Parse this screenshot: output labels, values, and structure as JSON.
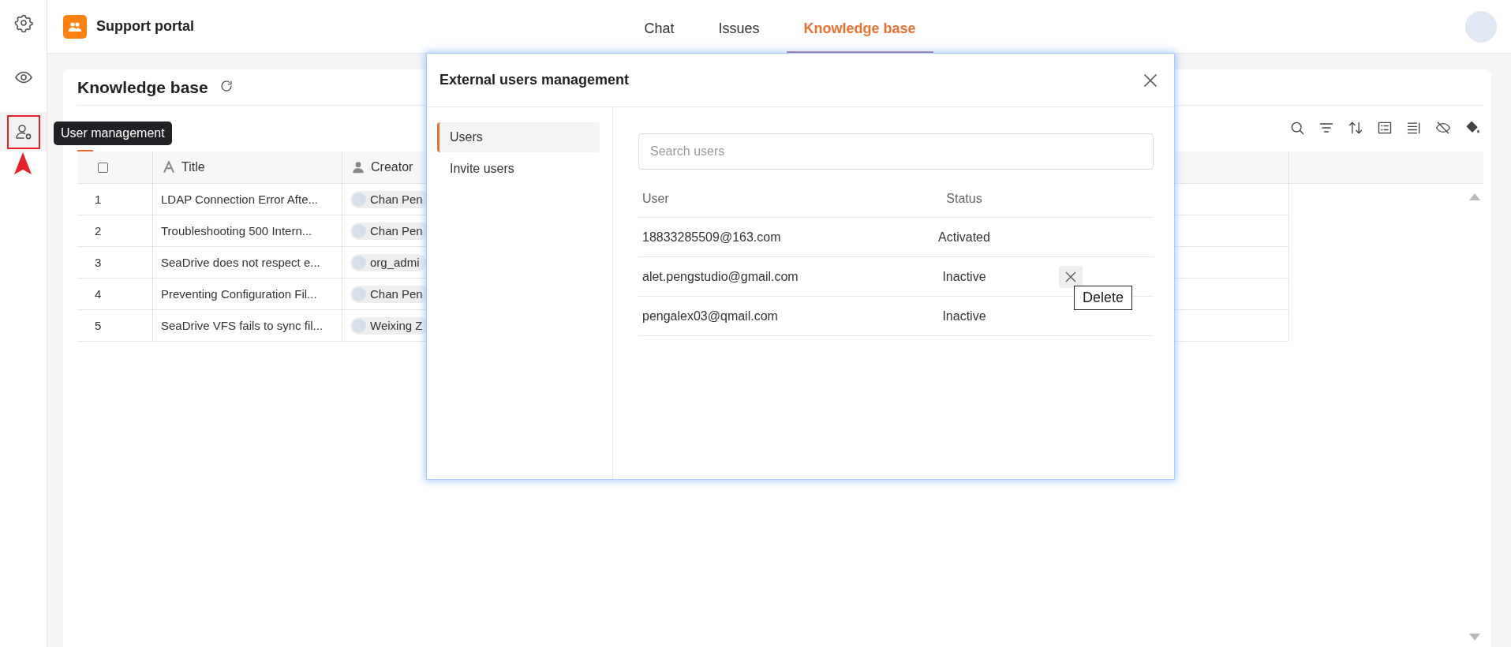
{
  "rail": {
    "items": [
      {
        "kind": "settings",
        "selected": false
      },
      {
        "kind": "preview",
        "selected": false
      },
      {
        "kind": "users",
        "selected": true
      }
    ]
  },
  "tooltip": "User management",
  "header": {
    "app_title": "Support portal",
    "tabs": [
      {
        "label": "Chat",
        "selected": false
      },
      {
        "label": "Issues",
        "selected": false
      },
      {
        "label": "Knowledge base",
        "selected": true
      }
    ]
  },
  "page": {
    "title": "Knowledge base"
  },
  "table": {
    "all_selected": false,
    "columns": [
      {
        "label": "Title",
        "kind": "text"
      },
      {
        "label": "Creator",
        "kind": "person"
      }
    ],
    "rows": [
      {
        "number": "1",
        "title": "LDAP Connection Error Afte...",
        "creator": "Chan Pen"
      },
      {
        "number": "2",
        "title": "Troubleshooting 500 Intern...",
        "creator": "Chan Pen"
      },
      {
        "number": "3",
        "title": "SeaDrive does not respect e...",
        "creator": "org_admi"
      },
      {
        "number": "4",
        "title": "Preventing Configuration Fil...",
        "creator": "Chan Pen"
      },
      {
        "number": "5",
        "title": "SeaDrive VFS fails to sync fil...",
        "creator": "Weixing Z"
      }
    ]
  },
  "dialog": {
    "title": "External users management",
    "nav": [
      {
        "label": "Users",
        "selected": true
      },
      {
        "label": "Invite users",
        "selected": false
      }
    ],
    "search": {
      "placeholder": "Search users"
    },
    "columns": [
      "User",
      "Status"
    ],
    "users": [
      {
        "email": "18833285509@163.com",
        "status": "Activated",
        "hovered": false
      },
      {
        "email": "alet.pengstudio@gmail.com",
        "status": "Inactive",
        "hovered": true
      },
      {
        "email": "pengalex03@qmail.com",
        "status": "Inactive",
        "hovered": false
      }
    ],
    "hover_tooltip": "Delete"
  }
}
